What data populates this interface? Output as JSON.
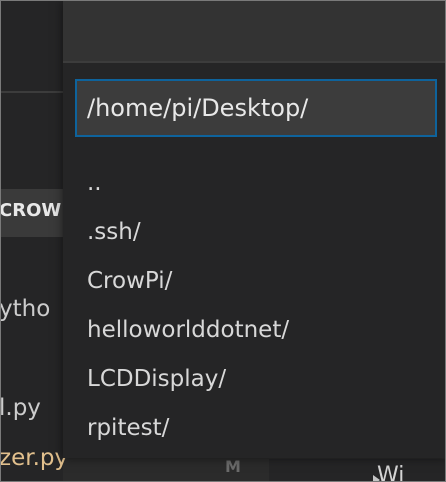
{
  "background": {
    "section_label": "CROW",
    "files": [
      "ytho",
      "l.py",
      "zer.py"
    ],
    "bottom_panel_label": "Wi",
    "bottom_panel_marker": "M"
  },
  "quick_open": {
    "input_value": "/home/pi/Desktop/",
    "items": [
      {
        "label": ".."
      },
      {
        "label": ".ssh/"
      },
      {
        "label": "CrowPi/"
      },
      {
        "label": "helloworlddotnet/"
      },
      {
        "label": "LCDDisplay/"
      },
      {
        "label": "rpitest/"
      }
    ]
  },
  "colors": {
    "dialog_bg": "#252526",
    "input_bg": "#3c3c3c",
    "input_border_focus": "#0e639c",
    "text": "#d8d8d8",
    "modified_file": "#e2c08d"
  }
}
